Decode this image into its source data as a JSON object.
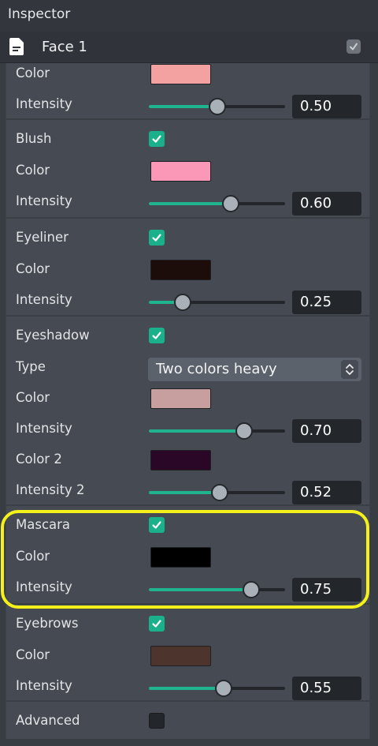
{
  "inspector": {
    "title": "Inspector"
  },
  "object": {
    "name": "Face 1",
    "enabled": true,
    "icon": "file-icon"
  },
  "sections": [
    {
      "id": "partial-top",
      "rows": [
        {
          "type": "color",
          "label": "Color",
          "color": "#f3a1a1"
        },
        {
          "type": "slider",
          "label": "Intensity",
          "value": 0.5,
          "display": "0.50"
        }
      ]
    },
    {
      "id": "blush",
      "title": "Blush",
      "enabled": true,
      "rows": [
        {
          "type": "color",
          "label": "Color",
          "color": "#fb97b7"
        },
        {
          "type": "slider",
          "label": "Intensity",
          "value": 0.6,
          "display": "0.60"
        }
      ]
    },
    {
      "id": "eyeliner",
      "title": "Eyeliner",
      "enabled": true,
      "rows": [
        {
          "type": "color",
          "label": "Color",
          "color": "#1d0d0a"
        },
        {
          "type": "slider",
          "label": "Intensity",
          "value": 0.25,
          "display": "0.25"
        }
      ]
    },
    {
      "id": "eyeshadow",
      "title": "Eyeshadow",
      "enabled": true,
      "rows": [
        {
          "type": "select",
          "label": "Type",
          "value": "Two colors heavy"
        },
        {
          "type": "color",
          "label": "Color",
          "color": "#c89f9f"
        },
        {
          "type": "slider",
          "label": "Intensity",
          "value": 0.7,
          "display": "0.70"
        },
        {
          "type": "color",
          "label": "Color 2",
          "color": "#2a0727"
        },
        {
          "type": "slider",
          "label": "Intensity 2",
          "value": 0.52,
          "display": "0.52"
        }
      ]
    },
    {
      "id": "mascara",
      "title": "Mascara",
      "enabled": true,
      "rows": [
        {
          "type": "color",
          "label": "Color",
          "color": "#000000"
        },
        {
          "type": "slider",
          "label": "Intensity",
          "value": 0.75,
          "display": "0.75"
        }
      ]
    },
    {
      "id": "eyebrows",
      "title": "Eyebrows",
      "enabled": true,
      "rows": [
        {
          "type": "color",
          "label": "Color",
          "color": "#4d342d"
        },
        {
          "type": "slider",
          "label": "Intensity",
          "value": 0.55,
          "display": "0.55"
        }
      ]
    },
    {
      "id": "advanced",
      "title": "Advanced",
      "enabled": false,
      "rows": []
    }
  ],
  "colors": {
    "accent": "#1fb38e",
    "highlight": "#f4f11a"
  }
}
